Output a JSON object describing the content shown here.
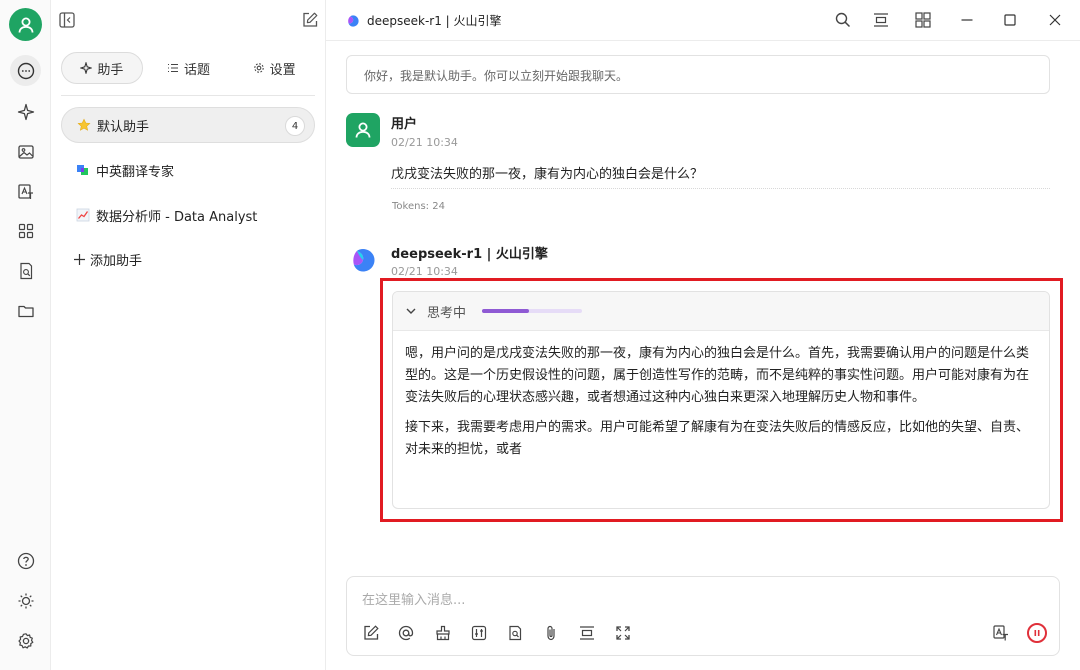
{
  "colors": {
    "accent_green": "#1fa463",
    "highlight_red": "#e11b22",
    "progress_purple": "#8f5ad4",
    "stop_red": "#e0303a"
  },
  "left_rail": {
    "icons": [
      "user-avatar",
      "chat-icon",
      "sparkle-icon",
      "image-icon",
      "translate-icon",
      "apps-icon",
      "document-search-icon",
      "folder-icon",
      "help-icon",
      "theme-icon",
      "settings-icon"
    ]
  },
  "sidebar": {
    "tabs": [
      {
        "label": "助手",
        "icon": "sparkle-icon",
        "active": true
      },
      {
        "label": "话题",
        "icon": "list-icon",
        "active": false
      },
      {
        "label": "设置",
        "icon": "gear-icon",
        "active": false
      }
    ],
    "assistants": [
      {
        "label": "默认助手",
        "icon": "star-icon",
        "badge": "4",
        "active": true
      },
      {
        "label": "中英翻译专家",
        "icon": "translate-emoji-icon"
      },
      {
        "label": "数据分析师 - Data Analyst",
        "icon": "chart-emoji-icon"
      }
    ],
    "add_label": "添加助手"
  },
  "header": {
    "model_title": "deepseek-r1 | 火山引擎"
  },
  "chat": {
    "notice": "你好，我是默认助手。你可以立刻开始跟我聊天。",
    "user_message": {
      "name": "用户",
      "time": "02/21 10:34",
      "text": "戊戌变法失败的那一夜，康有为内心的独白会是什么？",
      "tokens": "Tokens: 24"
    },
    "bot_message": {
      "name": "deepseek-r1 | 火山引擎",
      "time": "02/21 10:34",
      "thinking_label": "思考中",
      "thinking_progress": 0.47,
      "paragraphs": [
        "嗯，用户问的是戊戌变法失败的那一夜，康有为内心的独白会是什么。首先，我需要确认用户的问题是什么类型的。这是一个历史假设性的问题，属于创造性写作的范畴，而不是纯粹的事实性问题。用户可能对康有为在变法失败后的心理状态感兴趣，或者想通过这种内心独白来更深入地理解历史人物和事件。",
        "接下来，我需要考虑用户的需求。用户可能希望了解康有为在变法失败后的情感反应，比如他的失望、自责、对未来的担忧，或者"
      ]
    }
  },
  "input": {
    "placeholder": "在这里输入消息..."
  }
}
